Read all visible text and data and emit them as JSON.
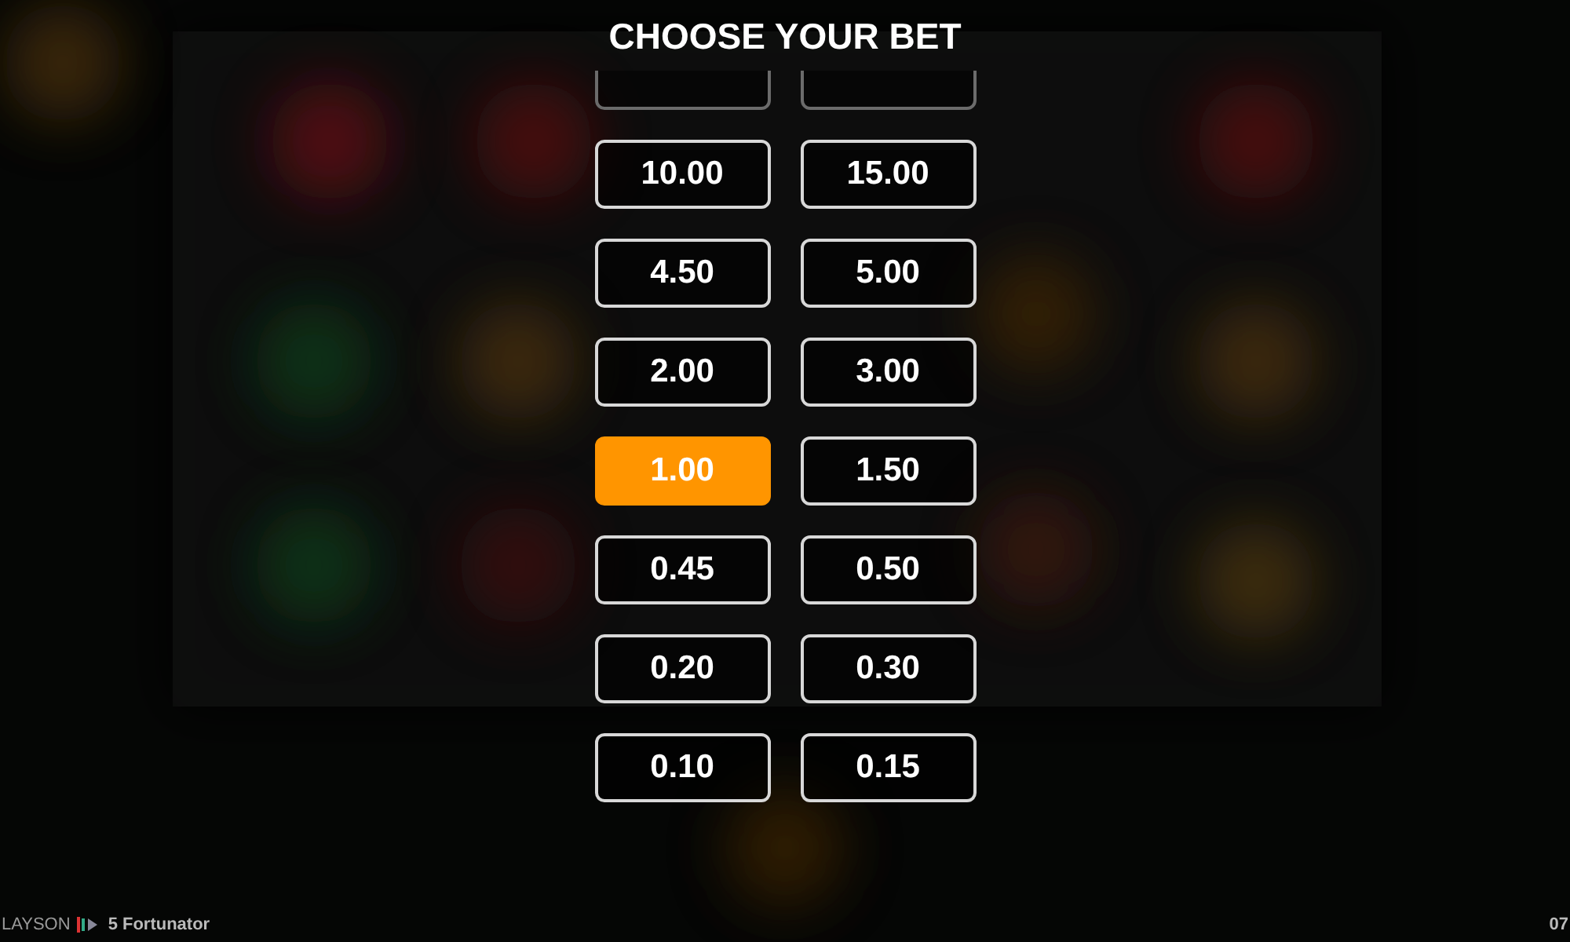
{
  "title": "CHOOSE YOUR BET",
  "bets": [
    {
      "kind": "cut",
      "selected": false
    },
    {
      "kind": "cut",
      "selected": false
    },
    {
      "kind": "bet",
      "label": "10.00",
      "selected": false
    },
    {
      "kind": "bet",
      "label": "15.00",
      "selected": false
    },
    {
      "kind": "bet",
      "label": "4.50",
      "selected": false
    },
    {
      "kind": "bet",
      "label": "5.00",
      "selected": false
    },
    {
      "kind": "bet",
      "label": "2.00",
      "selected": false
    },
    {
      "kind": "bet",
      "label": "3.00",
      "selected": false
    },
    {
      "kind": "bet",
      "label": "1.00",
      "selected": true
    },
    {
      "kind": "bet",
      "label": "1.50",
      "selected": false
    },
    {
      "kind": "bet",
      "label": "0.45",
      "selected": false
    },
    {
      "kind": "bet",
      "label": "0.50",
      "selected": false
    },
    {
      "kind": "bet",
      "label": "0.20",
      "selected": false
    },
    {
      "kind": "bet",
      "label": "0.30",
      "selected": false
    },
    {
      "kind": "bet",
      "label": "0.10",
      "selected": false
    },
    {
      "kind": "bet",
      "label": "0.15",
      "selected": false
    }
  ],
  "footer": {
    "brand": "LAYSON",
    "game": "5 Fortunator",
    "clock": "07"
  }
}
